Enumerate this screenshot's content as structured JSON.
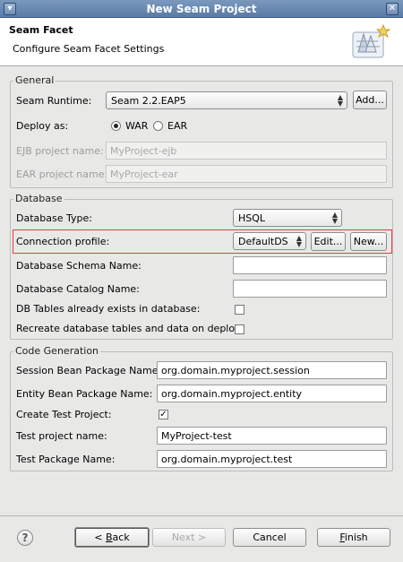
{
  "window": {
    "title": "New Seam Project"
  },
  "banner": {
    "title": "Seam Facet",
    "description": "Configure Seam Facet Settings"
  },
  "general": {
    "legend": "General",
    "runtime_label": "Seam Runtime:",
    "runtime_value": "Seam 2.2.EAP5",
    "add_label": "Add...",
    "deploy_label": "Deploy as:",
    "deploy_options": [
      {
        "label": "WAR",
        "selected": true
      },
      {
        "label": "EAR",
        "selected": false
      }
    ],
    "ejb_label": "EJB project name:",
    "ejb_value": "MyProject-ejb",
    "ear_label": "EAR project name:",
    "ear_value": "MyProject-ear"
  },
  "database": {
    "legend": "Database",
    "type_label": "Database Type:",
    "type_value": "HSQL",
    "profile_label": "Connection profile:",
    "profile_value": "DefaultDS",
    "edit_label": "Edit...",
    "new_label": "New...",
    "schema_label": "Database Schema Name:",
    "schema_value": "",
    "catalog_label": "Database Catalog Name:",
    "catalog_value": "",
    "tables_exist_label": "DB Tables already exists in database:",
    "tables_exist_checked": false,
    "recreate_label": "Recreate database tables and data on deploy:",
    "recreate_checked": false
  },
  "codegen": {
    "legend": "Code Generation",
    "session_label": "Session Bean Package Name:",
    "session_value": "org.domain.myproject.session",
    "entity_label": "Entity Bean Package Name:",
    "entity_value": "org.domain.myproject.entity",
    "create_test_label": "Create Test Project:",
    "create_test_checked": true,
    "test_project_label": "Test project name:",
    "test_project_value": "MyProject-test",
    "test_package_label": "Test Package Name:",
    "test_package_value": "org.domain.myproject.test"
  },
  "footer": {
    "back_prefix": "< ",
    "back_mnemonic": "B",
    "back_rest": "ack",
    "next_label": "Next >",
    "cancel_label": "Cancel",
    "finish_mnemonic": "F",
    "finish_rest": "inish"
  },
  "icons": {
    "help": "help-icon",
    "banner": "seam-facet-icon"
  }
}
